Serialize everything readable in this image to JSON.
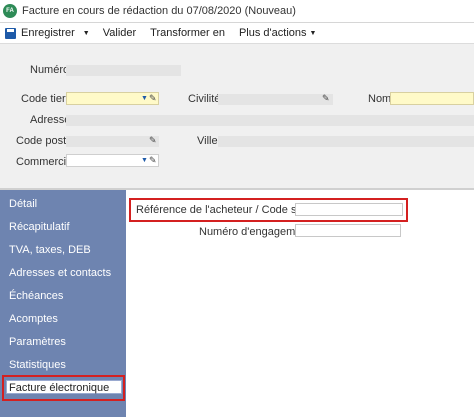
{
  "window": {
    "badge": "FA",
    "title": "Facture en cours de rédaction du 07/08/2020 (Nouveau)"
  },
  "toolbar": {
    "save_label": "Enregistrer",
    "validate_label": "Valider",
    "transform_label": "Transformer en",
    "more_label": "Plus d'actions"
  },
  "form": {
    "numero_label": "Numéro",
    "code_tiers_label": "Code tiers",
    "civilite_label": "Civilité",
    "nom_label": "Nom",
    "adresse_label": "Adresse",
    "code_postal_label": "Code postal",
    "ville_label": "Ville",
    "commercial_label": "Commercial"
  },
  "sidebar": {
    "items": [
      {
        "label": "Détail"
      },
      {
        "label": "Récapitulatif"
      },
      {
        "label": "TVA, taxes, DEB"
      },
      {
        "label": "Adresses et contacts"
      },
      {
        "label": "Échéances"
      },
      {
        "label": "Acomptes"
      },
      {
        "label": "Paramètres"
      },
      {
        "label": "Statistiques"
      }
    ],
    "selected_label": "Facture électronique"
  },
  "main": {
    "ref_acheteur_label": "Référence de l'acheteur / Code service",
    "ref_acheteur_value": "",
    "numero_engagement_label": "Numéro d'engagement",
    "numero_engagement_value": ""
  },
  "colors": {
    "sidebar_bg": "#6e84b0",
    "highlight_red": "#d42020",
    "required_yellow": "#fffac8",
    "accent_blue": "#1e5aa8"
  }
}
